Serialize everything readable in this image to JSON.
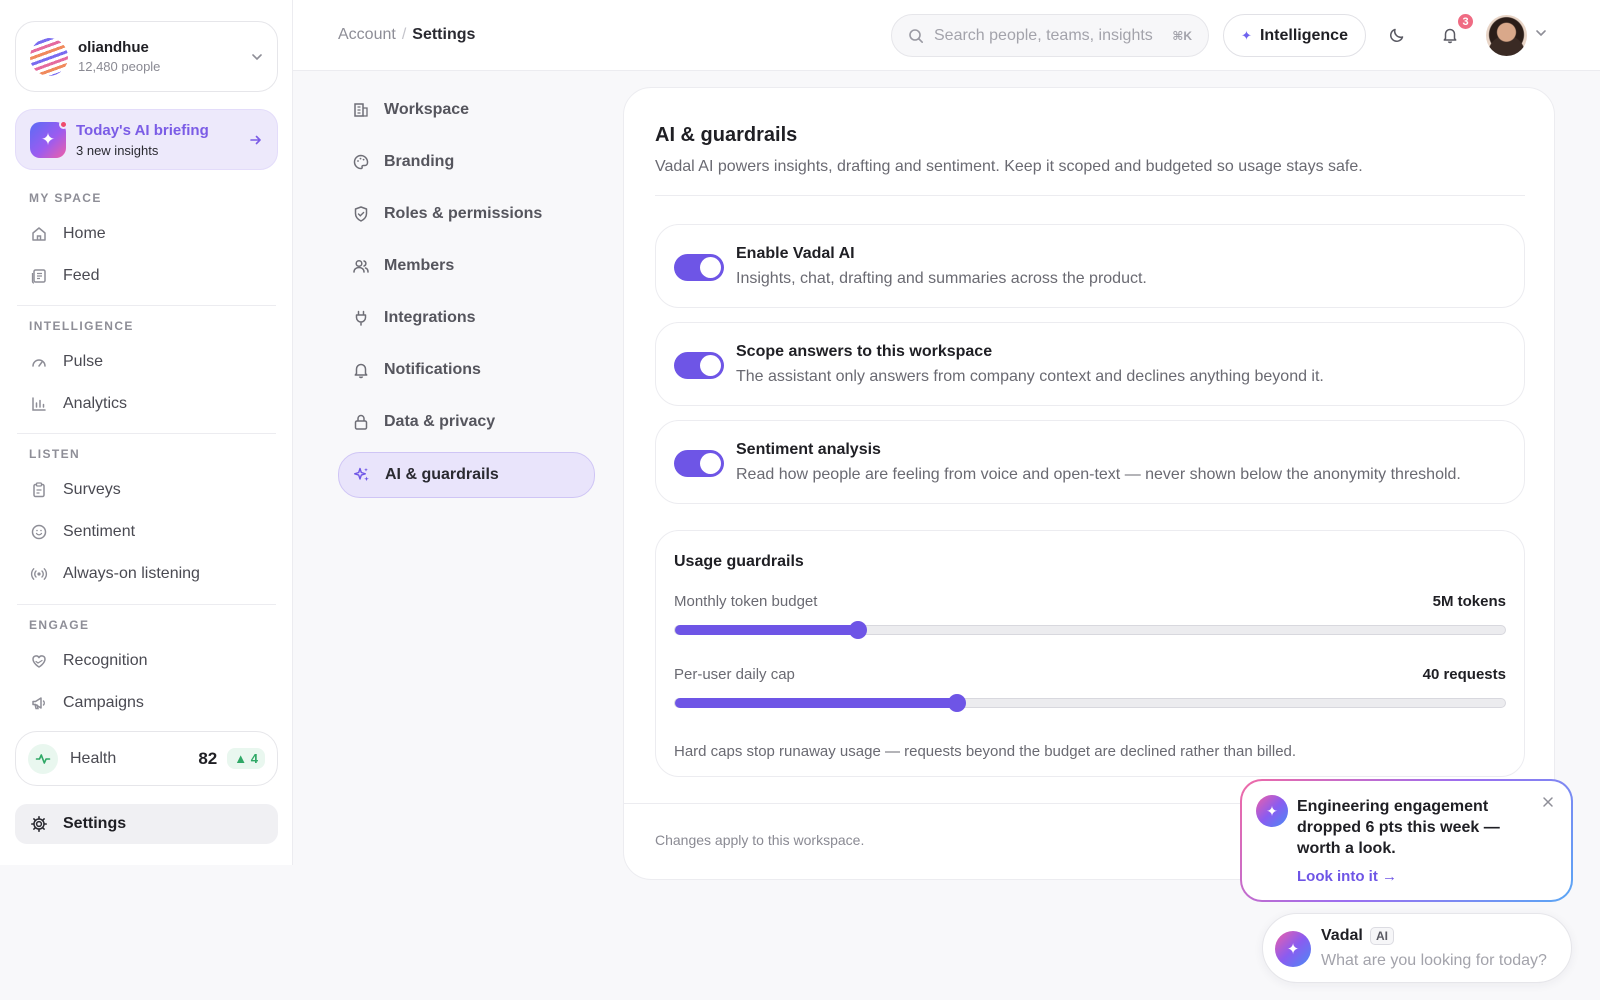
{
  "org": {
    "name": "oliandhue",
    "people": "12,480 people"
  },
  "briefing": {
    "title": "Today's AI briefing",
    "subtitle": "3 new insights"
  },
  "sidebar": {
    "sections": {
      "my_space": "MY SPACE",
      "intelligence": "INTELLIGENCE",
      "listen": "LISTEN",
      "engage": "ENGAGE"
    },
    "items": {
      "home": "Home",
      "feed": "Feed",
      "pulse": "Pulse",
      "analytics": "Analytics",
      "surveys": "Surveys",
      "sentiment": "Sentiment",
      "always_on": "Always-on listening",
      "recognition": "Recognition",
      "campaigns": "Campaigns",
      "settings": "Settings"
    },
    "health": {
      "label": "Health",
      "score": "82",
      "delta": "4"
    }
  },
  "header": {
    "breadcrumb": {
      "parent": "Account",
      "current": "Settings"
    },
    "search": {
      "placeholder": "Search people, teams, insights",
      "shortcut": "⌘K"
    },
    "intelligence_label": "Intelligence",
    "notification_count": "3"
  },
  "settings_nav": {
    "workspace": "Workspace",
    "branding": "Branding",
    "roles": "Roles & permissions",
    "members": "Members",
    "integrations": "Integrations",
    "notifications": "Notifications",
    "data_privacy": "Data & privacy",
    "ai_guardrails": "AI & guardrails"
  },
  "panel": {
    "title": "AI & guardrails",
    "subtitle": "Vadal AI powers insights, drafting and sentiment. Keep it scoped and budgeted so usage stays safe.",
    "toggles": [
      {
        "title": "Enable Vadal AI",
        "desc": "Insights, chat, drafting and summaries across the product.",
        "on": true
      },
      {
        "title": "Scope answers to this workspace",
        "desc": "The assistant only answers from company context and declines anything beyond it.",
        "on": true
      },
      {
        "title": "Sentiment analysis",
        "desc": "Read how people are feeling from voice and open-text — never shown below the anonymity threshold.",
        "on": true
      }
    ],
    "usage": {
      "title": "Usage guardrails",
      "token_budget": {
        "label": "Monthly token budget",
        "value": "5M tokens",
        "level": 0.22
      },
      "daily_cap": {
        "label": "Per-user daily cap",
        "value": "40 requests",
        "level": 0.34
      },
      "note": "Hard caps stop runaway usage — requests beyond the budget are declined rather than billed."
    },
    "footer": "Changes apply to this workspace."
  },
  "toast": {
    "message": "Engineering engagement dropped 6 pts this week — worth a look.",
    "link": "Look into it →"
  },
  "assistant": {
    "name": "Vadal",
    "badge": "AI",
    "placeholder": "What are you looking for today?"
  },
  "colors": {
    "accent": "#6e55e6",
    "positive": "#2fa866",
    "badge": "#ef6b83"
  }
}
